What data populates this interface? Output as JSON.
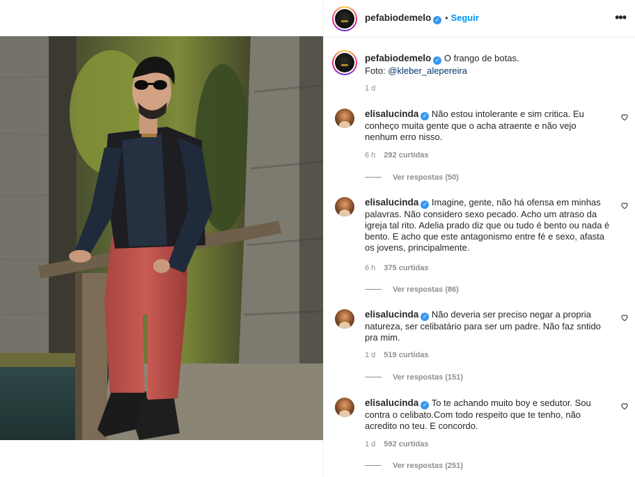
{
  "post": {
    "username": "pefabiodemelo",
    "verified_icon": "verified-badge-icon",
    "separator": "•",
    "follow_label": "Seguir",
    "more_icon": "more-options-icon",
    "more_glyph": "•••"
  },
  "caption": {
    "username": "pefabiodemelo",
    "text": "O frango de botas.",
    "credit_prefix": "Foto: ",
    "credit_mention": "@kleber_alepereira",
    "time": "1 d"
  },
  "comments": [
    {
      "username": "elisalucinda",
      "text": "Não estou intolerante e sim critica. Eu conheço muita gente que o acha atraente e não vejo nenhum erro nisso.",
      "time": "6 h",
      "likes": "292 curtidas",
      "replies": "Ver respostas (50)"
    },
    {
      "username": "elisalucinda",
      "text": "Imagine, gente, não há ofensa em minhas palavras. Não considero sexo pecado. Acho um atraso da igreja tal rito. Adelia prado diz que ou tudo é bento ou nada é bento. E acho que este antagonismo entre fé e sexo, afasta os jovens, principalmente.",
      "time": "6 h",
      "likes": "375 curtidas",
      "replies": "Ver respostas (86)"
    },
    {
      "username": "elisalucinda",
      "text": "Não deveria ser preciso negar a propria natureza, ser celibatário para ser um padre. Não faz sntido pra mim.",
      "time": "1 d",
      "likes": "519 curtidas",
      "replies": "Ver respostas (151)"
    },
    {
      "username": "elisalucinda",
      "text": "To te achando muito boy e sedutor. Sou contra o celibato.Com todo respeito que te tenho, não acredito no teu. E concordo.",
      "time": "1 d",
      "likes": "592 curtidas",
      "replies": "Ver respostas (251)"
    }
  ],
  "colors": {
    "follow": "#0095f6",
    "mention": "#00376b",
    "muted": "#8e8e8e",
    "verified": "#3897f0"
  }
}
